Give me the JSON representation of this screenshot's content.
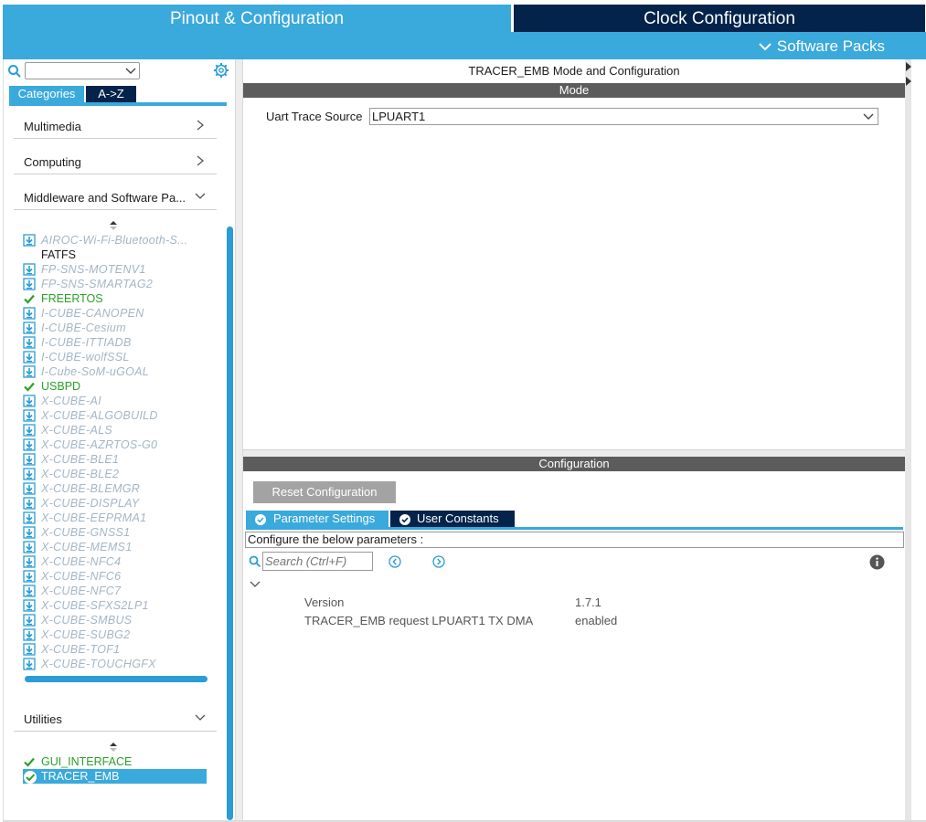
{
  "header": {
    "tab_pinout": "Pinout & Configuration",
    "tab_clock": "Clock Configuration",
    "software_packs": "Software Packs"
  },
  "left": {
    "tab_categories": "Categories",
    "tab_az": "A->Z",
    "categories": [
      {
        "label": "Multimedia",
        "state": "collapsed"
      },
      {
        "label": "Computing",
        "state": "collapsed"
      },
      {
        "label": "Middleware and Software Pa...",
        "state": "expanded"
      },
      {
        "label": "Utilities",
        "state": "expanded"
      }
    ],
    "middleware_items": [
      {
        "label": "AIROC-Wi-Fi-Bluetooth-S...",
        "kind": "pkg"
      },
      {
        "label": "FATFS",
        "kind": "plain"
      },
      {
        "label": "FP-SNS-MOTENV1",
        "kind": "pkg"
      },
      {
        "label": "FP-SNS-SMARTAG2",
        "kind": "pkg"
      },
      {
        "label": "FREERTOS",
        "kind": "ok"
      },
      {
        "label": "I-CUBE-CANOPEN",
        "kind": "pkg"
      },
      {
        "label": "I-CUBE-Cesium",
        "kind": "pkg"
      },
      {
        "label": "I-CUBE-ITTIADB",
        "kind": "pkg"
      },
      {
        "label": "I-CUBE-wolfSSL",
        "kind": "pkg"
      },
      {
        "label": "I-Cube-SoM-uGOAL",
        "kind": "pkg"
      },
      {
        "label": "USBPD",
        "kind": "ok"
      },
      {
        "label": "X-CUBE-AI",
        "kind": "pkg"
      },
      {
        "label": "X-CUBE-ALGOBUILD",
        "kind": "pkg"
      },
      {
        "label": "X-CUBE-ALS",
        "kind": "pkg"
      },
      {
        "label": "X-CUBE-AZRTOS-G0",
        "kind": "pkg"
      },
      {
        "label": "X-CUBE-BLE1",
        "kind": "pkg"
      },
      {
        "label": "X-CUBE-BLE2",
        "kind": "pkg"
      },
      {
        "label": "X-CUBE-BLEMGR",
        "kind": "pkg"
      },
      {
        "label": "X-CUBE-DISPLAY",
        "kind": "pkg"
      },
      {
        "label": "X-CUBE-EEPRMA1",
        "kind": "pkg"
      },
      {
        "label": "X-CUBE-GNSS1",
        "kind": "pkg"
      },
      {
        "label": "X-CUBE-MEMS1",
        "kind": "pkg"
      },
      {
        "label": "X-CUBE-NFC4",
        "kind": "pkg"
      },
      {
        "label": "X-CUBE-NFC6",
        "kind": "pkg"
      },
      {
        "label": "X-CUBE-NFC7",
        "kind": "pkg"
      },
      {
        "label": "X-CUBE-SFXS2LP1",
        "kind": "pkg"
      },
      {
        "label": "X-CUBE-SMBUS",
        "kind": "pkg"
      },
      {
        "label": "X-CUBE-SUBG2",
        "kind": "pkg"
      },
      {
        "label": "X-CUBE-TOF1",
        "kind": "pkg"
      },
      {
        "label": "X-CUBE-TOUCHGFX",
        "kind": "pkg"
      }
    ],
    "utility_items": [
      {
        "label": "GUI_INTERFACE",
        "kind": "ok",
        "selected": false
      },
      {
        "label": "TRACER_EMB",
        "kind": "ok",
        "selected": true
      }
    ]
  },
  "mode": {
    "title": "TRACER_EMB Mode and Configuration",
    "bar": "Mode",
    "uart_label": "Uart Trace Source",
    "uart_value": "LPUART1"
  },
  "config": {
    "bar": "Configuration",
    "reset_button": "Reset Configuration",
    "tab_params": "Parameter Settings",
    "tab_constants": "User Constants",
    "description": "Configure the below parameters :",
    "search_placeholder": "Search (Ctrl+F)",
    "params": [
      {
        "name": "Version",
        "value": "1.7.1"
      },
      {
        "name": "TRACER_EMB request LPUART1 TX DMA",
        "value": "enabled"
      }
    ]
  },
  "colors": {
    "header_blue": "#3aa9dc",
    "navy": "#03234b",
    "bar_gray": "#5c5c5c",
    "ok_green": "#2aa02a",
    "pkg_gray_blue": "#a3b6c6"
  }
}
